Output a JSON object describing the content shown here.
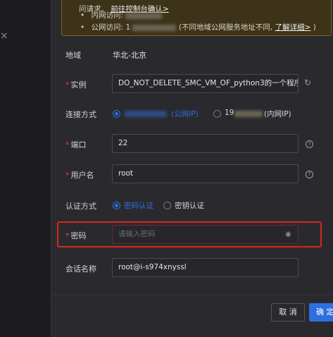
{
  "notice": {
    "line1_prefix": "问请求。",
    "line1_link": "前往控制台确认>",
    "intranet_label": "内网访问:",
    "public_label": "公网访问:",
    "public_prefix": "1",
    "public_note": "(不同地域公网服务地址不同,",
    "public_link": "了解详细>",
    "public_suffix": ")"
  },
  "form": {
    "region": {
      "label": "地域",
      "value": "华北-北京"
    },
    "instance": {
      "label": "实例",
      "value": "DO_NOT_DELETE_SMC_VM_OF_python3的一个程序"
    },
    "connection": {
      "label": "连接方式",
      "option_public_tag": "(公网IP)",
      "option_private_prefix": "19",
      "option_private_tag": "(内网IP)"
    },
    "port": {
      "label": "端口",
      "value": "22"
    },
    "username": {
      "label": "用户名",
      "value": "root"
    },
    "auth": {
      "label": "认证方式",
      "option_password": "密码认证",
      "option_key": "密钥认证"
    },
    "password": {
      "label": "密码",
      "placeholder": "请输入密码"
    },
    "session": {
      "label": "会话名称",
      "value": "root@i-s974xnyssl"
    }
  },
  "footer": {
    "cancel_label": "取 消",
    "confirm_label": "确 定"
  },
  "colors": {
    "accent": "#2e6fe0",
    "required": "#e23c3c",
    "highlight": "#d9261c",
    "notice_bg": "#3d3318"
  }
}
